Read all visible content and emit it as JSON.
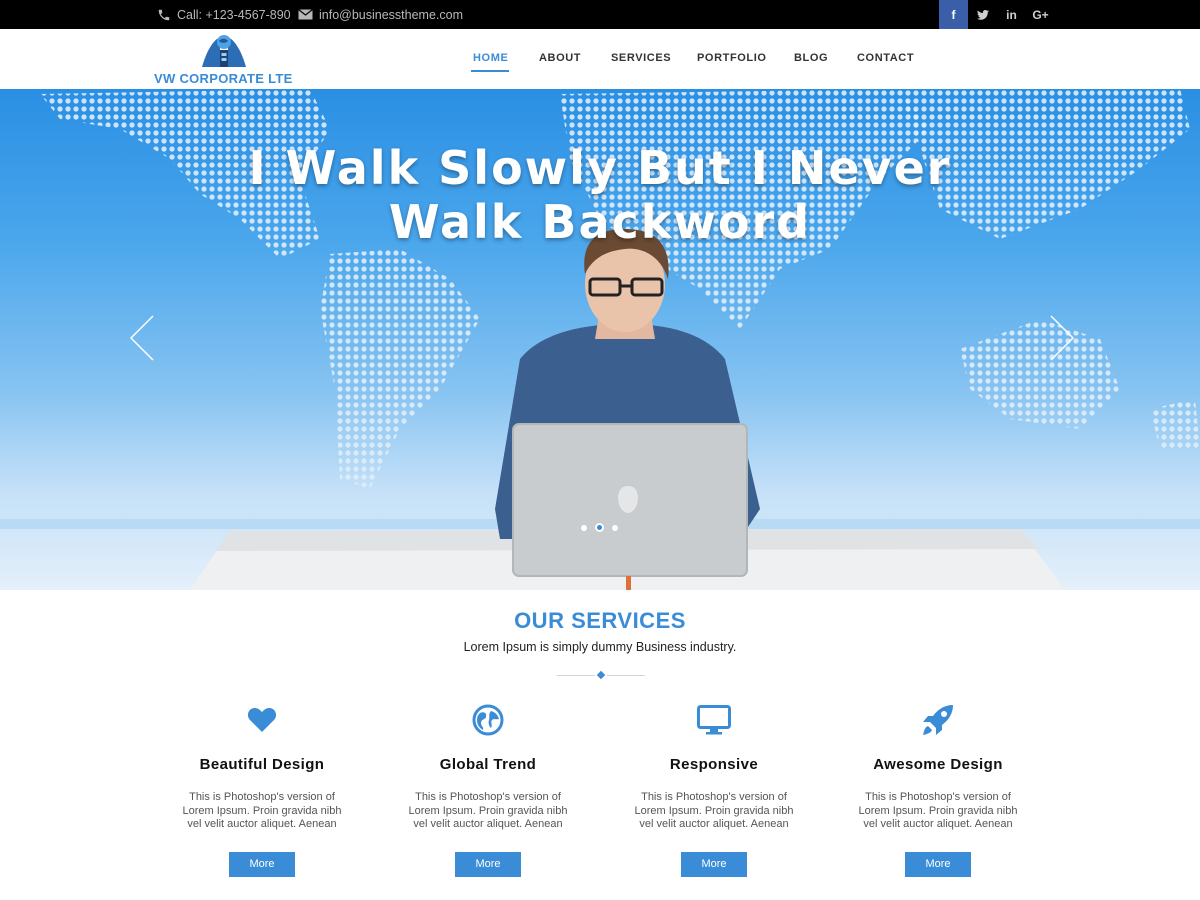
{
  "topbar": {
    "phone": "Call: +123-4567-890",
    "email": "info@businesstheme.com",
    "social": [
      {
        "icon": "facebook-icon",
        "glyph": "f"
      },
      {
        "icon": "twitter-icon",
        "glyph": "t"
      },
      {
        "icon": "linkedin-icon",
        "glyph": "in"
      },
      {
        "icon": "google-plus-icon",
        "glyph": "G+"
      }
    ]
  },
  "brand": {
    "name": "VW CORPORATE LTE"
  },
  "nav": {
    "home": "HOME",
    "about": "ABOUT",
    "services": "SERVICES",
    "portfolio": "PORTFOLIO",
    "blog": "BLOG",
    "contact": "CONTACT",
    "active": "HOME"
  },
  "hero": {
    "line1": "I Walk Slowly But I Never",
    "line2": "Walk Backword",
    "slides": 3,
    "active_slide": 2
  },
  "services": {
    "title": "OUR SERVICES",
    "subtitle": "Lorem Ipsum is simply dummy Business industry.",
    "items": [
      {
        "icon": "heart-icon",
        "title": "Beautiful Design",
        "text": "This is Photoshop's version  of Lorem Ipsum. Proin gravida nibh vel velit auctor aliquet. Aenean",
        "button": "More"
      },
      {
        "icon": "globe-icon",
        "title": "Global Trend",
        "text": "This is Photoshop's version  of Lorem Ipsum. Proin gravida nibh vel velit auctor aliquet. Aenean",
        "button": "More"
      },
      {
        "icon": "monitor-icon",
        "title": "Responsive",
        "text": "This is Photoshop's version  of Lorem Ipsum. Proin gravida nibh vel velit auctor aliquet. Aenean",
        "button": "More"
      },
      {
        "icon": "rocket-icon",
        "title": "Awesome Design",
        "text": "This is Photoshop's version  of Lorem Ipsum. Proin gravida nibh vel velit auctor aliquet. Aenean",
        "button": "More"
      }
    ]
  },
  "colors": {
    "accent": "#3a8cd6",
    "topbar": "#000000",
    "facebook": "#3a5ea8"
  }
}
